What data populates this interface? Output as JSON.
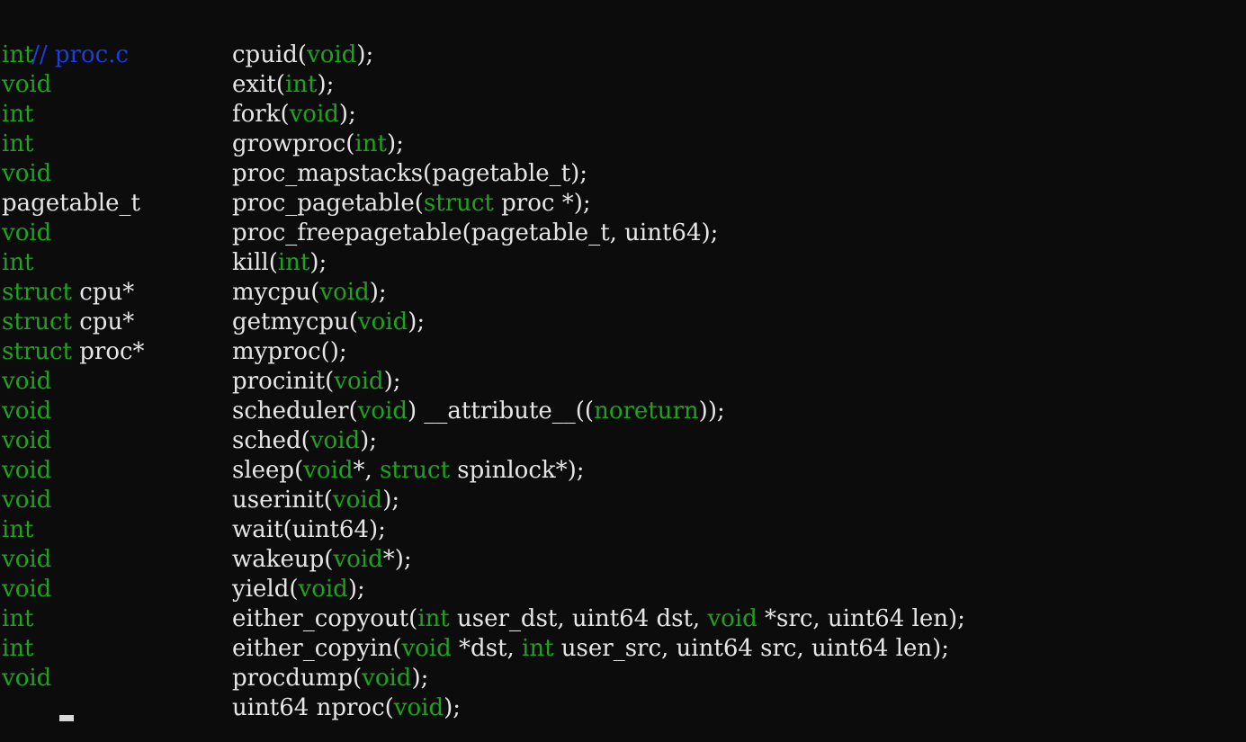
{
  "colors": {
    "background": "#0c0c0c",
    "keyword": "#1fa31f",
    "text": "#e6e6e6",
    "comment": "#1a3ee0"
  },
  "editor": {
    "comment": "// proc.c",
    "lines": [
      {
        "ret": [
          {
            "t": "int",
            "k": "kw"
          }
        ],
        "decl": [
          {
            "t": "cpuid(",
            "k": "plain"
          },
          {
            "t": "void",
            "k": "kw"
          },
          {
            "t": ");",
            "k": "plain"
          }
        ]
      },
      {
        "ret": [
          {
            "t": "void",
            "k": "kw"
          }
        ],
        "decl": [
          {
            "t": "exit(",
            "k": "plain"
          },
          {
            "t": "int",
            "k": "kw"
          },
          {
            "t": ");",
            "k": "plain"
          }
        ]
      },
      {
        "ret": [
          {
            "t": "int",
            "k": "kw"
          }
        ],
        "decl": [
          {
            "t": "fork(",
            "k": "plain"
          },
          {
            "t": "void",
            "k": "kw"
          },
          {
            "t": ");",
            "k": "plain"
          }
        ]
      },
      {
        "ret": [
          {
            "t": "int",
            "k": "kw"
          }
        ],
        "decl": [
          {
            "t": "growproc(",
            "k": "plain"
          },
          {
            "t": "int",
            "k": "kw"
          },
          {
            "t": ");",
            "k": "plain"
          }
        ]
      },
      {
        "ret": [
          {
            "t": "void",
            "k": "kw"
          }
        ],
        "decl": [
          {
            "t": "proc_mapstacks(pagetable_t);",
            "k": "plain"
          }
        ]
      },
      {
        "ret": [
          {
            "t": "pagetable_t",
            "k": "plain"
          }
        ],
        "decl": [
          {
            "t": "proc_pagetable(",
            "k": "plain"
          },
          {
            "t": "struct",
            "k": "kw"
          },
          {
            "t": " proc *);",
            "k": "plain"
          }
        ]
      },
      {
        "ret": [
          {
            "t": "void",
            "k": "kw"
          }
        ],
        "decl": [
          {
            "t": "proc_freepagetable(pagetable_t, uint64);",
            "k": "plain"
          }
        ]
      },
      {
        "ret": [
          {
            "t": "int",
            "k": "kw"
          }
        ],
        "decl": [
          {
            "t": "kill(",
            "k": "plain"
          },
          {
            "t": "int",
            "k": "kw"
          },
          {
            "t": ");",
            "k": "plain"
          }
        ]
      },
      {
        "ret": [
          {
            "t": "struct",
            "k": "kw"
          },
          {
            "t": " cpu*",
            "k": "plain"
          }
        ],
        "decl": [
          {
            "t": "mycpu(",
            "k": "plain"
          },
          {
            "t": "void",
            "k": "kw"
          },
          {
            "t": ");",
            "k": "plain"
          }
        ]
      },
      {
        "ret": [
          {
            "t": "struct",
            "k": "kw"
          },
          {
            "t": " cpu*",
            "k": "plain"
          }
        ],
        "decl": [
          {
            "t": "getmycpu(",
            "k": "plain"
          },
          {
            "t": "void",
            "k": "kw"
          },
          {
            "t": ");",
            "k": "plain"
          }
        ]
      },
      {
        "ret": [
          {
            "t": "struct",
            "k": "kw"
          },
          {
            "t": " proc*",
            "k": "plain"
          }
        ],
        "decl": [
          {
            "t": "myproc();",
            "k": "plain"
          }
        ]
      },
      {
        "ret": [
          {
            "t": "void",
            "k": "kw"
          }
        ],
        "decl": [
          {
            "t": "procinit(",
            "k": "plain"
          },
          {
            "t": "void",
            "k": "kw"
          },
          {
            "t": ");",
            "k": "plain"
          }
        ]
      },
      {
        "ret": [
          {
            "t": "void",
            "k": "kw"
          }
        ],
        "decl": [
          {
            "t": "scheduler(",
            "k": "plain"
          },
          {
            "t": "void",
            "k": "kw"
          },
          {
            "t": ") __attribute__((",
            "k": "plain"
          },
          {
            "t": "noreturn",
            "k": "kw"
          },
          {
            "t": "));",
            "k": "plain"
          }
        ]
      },
      {
        "ret": [
          {
            "t": "void",
            "k": "kw"
          }
        ],
        "decl": [
          {
            "t": "sched(",
            "k": "plain"
          },
          {
            "t": "void",
            "k": "kw"
          },
          {
            "t": ");",
            "k": "plain"
          }
        ]
      },
      {
        "ret": [
          {
            "t": "void",
            "k": "kw"
          }
        ],
        "decl": [
          {
            "t": "sleep(",
            "k": "plain"
          },
          {
            "t": "void",
            "k": "kw"
          },
          {
            "t": "*, ",
            "k": "plain"
          },
          {
            "t": "struct",
            "k": "kw"
          },
          {
            "t": " spinlock*);",
            "k": "plain"
          }
        ]
      },
      {
        "ret": [
          {
            "t": "void",
            "k": "kw"
          }
        ],
        "decl": [
          {
            "t": "userinit(",
            "k": "plain"
          },
          {
            "t": "void",
            "k": "kw"
          },
          {
            "t": ");",
            "k": "plain"
          }
        ]
      },
      {
        "ret": [
          {
            "t": "int",
            "k": "kw"
          }
        ],
        "decl": [
          {
            "t": "wait(uint64);",
            "k": "plain"
          }
        ]
      },
      {
        "ret": [
          {
            "t": "void",
            "k": "kw"
          }
        ],
        "decl": [
          {
            "t": "wakeup(",
            "k": "plain"
          },
          {
            "t": "void",
            "k": "kw"
          },
          {
            "t": "*);",
            "k": "plain"
          }
        ]
      },
      {
        "ret": [
          {
            "t": "void",
            "k": "kw"
          }
        ],
        "decl": [
          {
            "t": "yield(",
            "k": "plain"
          },
          {
            "t": "void",
            "k": "kw"
          },
          {
            "t": ");",
            "k": "plain"
          }
        ]
      },
      {
        "ret": [
          {
            "t": "int",
            "k": "kw"
          }
        ],
        "decl": [
          {
            "t": "either_copyout(",
            "k": "plain"
          },
          {
            "t": "int",
            "k": "kw"
          },
          {
            "t": " user_dst, uint64 dst, ",
            "k": "plain"
          },
          {
            "t": "void",
            "k": "kw"
          },
          {
            "t": " *src, uint64 len);",
            "k": "plain"
          }
        ]
      },
      {
        "ret": [
          {
            "t": "int",
            "k": "kw"
          }
        ],
        "decl": [
          {
            "t": "either_copyin(",
            "k": "plain"
          },
          {
            "t": "void",
            "k": "kw"
          },
          {
            "t": " *dst, ",
            "k": "plain"
          },
          {
            "t": "int",
            "k": "kw"
          },
          {
            "t": " user_src, uint64 src, uint64 len);",
            "k": "plain"
          }
        ]
      },
      {
        "ret": [
          {
            "t": "void",
            "k": "kw"
          }
        ],
        "decl": [
          {
            "t": "procdump(",
            "k": "plain"
          },
          {
            "t": "void",
            "k": "kw"
          },
          {
            "t": ");",
            "k": "plain"
          }
        ]
      },
      {
        "ret": [],
        "decl": [
          {
            "t": "uint64 nproc(",
            "k": "plain"
          },
          {
            "t": "void",
            "k": "kw"
          },
          {
            "t": ");",
            "k": "plain"
          }
        ]
      }
    ]
  }
}
